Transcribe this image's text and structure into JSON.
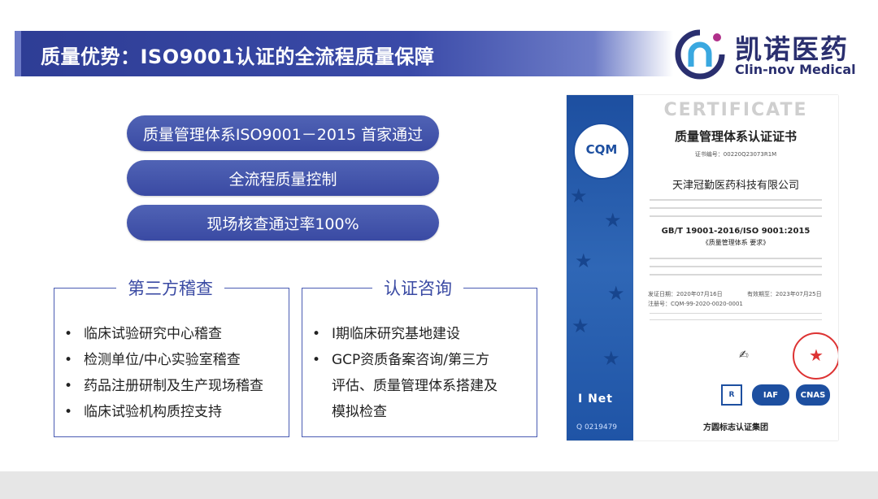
{
  "title": "质量优势：ISO9001认证的全流程质量保障",
  "logo": {
    "cn": "凯诺医药",
    "en": "Clin-nov Medical"
  },
  "pills": [
    "质量管理体系ISO9001－2015 首家通过",
    "全流程质量控制",
    "现场核查通过率100%"
  ],
  "third_party": {
    "title": "第三方稽查",
    "items": [
      "临床试验研究中心稽查",
      "检测单位/中心实验室稽查",
      "药品注册研制及生产现场稽查",
      "临床试验机构质控支持"
    ]
  },
  "consulting": {
    "title": "认证咨询",
    "lines": [
      "I期临床研究基地建设",
      "GCP资质备案咨询/第三方",
      "评估、质量管理体系搭建及",
      "模拟检查"
    ]
  },
  "certificate": {
    "word": "CERTIFICATE",
    "title": "质量管理体系认证证书",
    "cert_no": "证书编号：00220Q23073R1M",
    "company": "天津冠勤医药科技有限公司",
    "standard": "GB/T 19001-2016/ISO 9001:2015",
    "standard_sub": "《质量管理体系 要求》",
    "issue_date": "发证日期：2020年07月16日",
    "valid_to": "有效期至：2023年07月25日",
    "reg_no": "注册号：CQM-99-2020-0020-0001",
    "badge": "CQM",
    "net": "I Net",
    "serial": "Q 0219479",
    "mark_iaf": "IAF",
    "mark_cnas": "CNAS",
    "group": "方圆标志认证集团"
  }
}
